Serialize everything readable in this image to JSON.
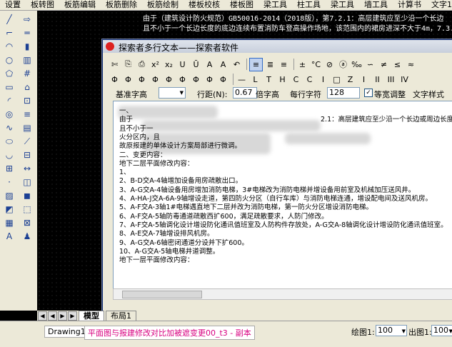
{
  "menubar": [
    "设置",
    "板转图",
    "板筋编辑",
    "板筋删除",
    "板筋绘制",
    "楼板校核",
    "楼板图",
    "梁工具",
    "柱工具",
    "梁工具",
    "墙工具",
    "计算书",
    "文字1"
  ],
  "left_tools": {
    "col1": [
      "line-icon",
      "polyline-icon",
      "arc-icon",
      "circle-icon",
      "polygon-icon",
      "rectangle-icon",
      "arc2-icon",
      "circle2-icon",
      "spline-icon",
      "ellipse-icon",
      "ellipse-arc-icon",
      "insert-icon",
      "point-icon",
      "hatch-icon",
      "region-icon",
      "table-icon",
      "mtext-icon"
    ],
    "col2": [
      "arrow-icon",
      "beam-icon",
      "column-icon",
      "wall-icon",
      "grid-icon",
      "door-icon",
      "window-icon",
      "stair-icon",
      "slab-icon",
      "rebar-icon",
      "section-icon",
      "dimension-icon",
      "layer-icon",
      "block-icon",
      "select-icon",
      "tag-icon",
      "person-icon"
    ]
  },
  "canvas_texts": {
    "line1": "由于（建筑设计防火规范）GB50016-2014（2018版），第7.2.1：高层建筑应至少沿一个长边",
    "line2": "且不小于一个长边长度的底边连续布置消防车登高操作场地，该范围内的裙房进深不大于4m，7.3.2"
  },
  "tabs": {
    "model": "模型",
    "layout": "布局1"
  },
  "status": {
    "doc1": "Drawing1",
    "doc2": "平面图与报建修改对比加被遮变更00_t3 - 副本",
    "plot_scale_label": "绘图1:",
    "plot_scale_value": "100",
    "output_label": "出图1:",
    "output_value": "100"
  },
  "dialog": {
    "title": "探索者多行文本——探索者软件",
    "toolbar_row1": [
      "✄",
      "⎘",
      "⎙",
      "x²",
      "x₂",
      "U",
      "Ū",
      "A",
      "A",
      "↶",
      "≡",
      "≣",
      "≡",
      "±",
      "°C",
      "⊘",
      "ⓐ",
      "‰",
      "∽",
      "≠",
      "≤",
      "≈"
    ],
    "toolbar_row2": [
      "Φ",
      "Φ",
      "Φ",
      "Φ",
      "Φ",
      "Φ",
      "Φ",
      "Φ",
      "Φ",
      "—",
      "L",
      "T",
      "H",
      "C",
      "C",
      "I",
      "□",
      "Z",
      "I",
      "II",
      "III",
      "IV"
    ],
    "options": {
      "base_height_label": "基准字高",
      "line_spacing_label": "行距(N):",
      "line_spacing_value": "0.67",
      "line_spacing_unit": "倍字高",
      "chars_per_line_label": "每行字符",
      "chars_per_line_value": "128",
      "equal_width_checkbox": "等宽调整",
      "text_style_label": "文字样式"
    },
    "lines": [
      "一、",
      "由于",
      "且不小于一",
      "火分区内，且",
      "故原报建的单体设计方案局部进行微调。",
      "二、变更内容：",
      "地下二层平面修改内容：",
      "1、",
      "2、B-D交A-4轴增加设备用房疏散出口。",
      "3、A-G交A-4轴设备用房增加消防电梯，3#电梯改为消防电梯并增设备用前室及机械加压送风井。",
      "4、A-HA-J交A-6A-9轴增设走道，第四防火分区（自行车库）与消防电梯连通，增设配电间及送风机房。",
      "5、A-F交A-3轴1#电梯遇直地下二层并改为消防电梯，第一防火分区增设消防电梯。",
      "6、A-F交A-5轴防毒通道疏散西扩600，满足疏散要求，人防门修改。",
      "7、A-F交A-5轴调化设计增设防化通讯值班室及人防构件存放处，A-G交A-8轴调化设计增设防化通讯值班室。",
      "8、A-E交A-7轴增设排风机房。",
      "9、A-G交A-6轴密闭通道分设并下扩600。",
      "10、A-G交A-5轴电梯井道调整。",
      "地下一层平面修改内容："
    ],
    "line2_tail": "2.1：高层建筑应至少沿一个长边或周边长度的"
  }
}
